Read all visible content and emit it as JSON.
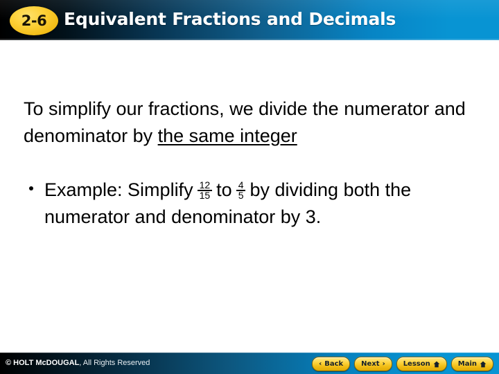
{
  "header": {
    "badge_label": "2-6",
    "title": "Equivalent Fractions and Decimals",
    "gradient_from": "#000000",
    "gradient_to": "#0894d3",
    "badge_color": "#fdd037"
  },
  "body": {
    "paragraph": {
      "lead": "To simplify our fractions, we divide the numerator and denominator by ",
      "emphasis": "the same integer"
    },
    "bullet": {
      "marker": "bullet-dot",
      "part1": "Example:  Simplify",
      "fraction1": {
        "numerator": "12",
        "denominator": "15"
      },
      "part2": "to",
      "fraction2": {
        "numerator": "4",
        "denominator": "5"
      },
      "part3": "by dividing both the numerator and denominator by 3."
    }
  },
  "footer": {
    "copyright_brand": "© HOLT McDOUGAL",
    "copyright_rest": ", All Rights Reserved",
    "buttons": [
      {
        "label": "Back",
        "icon": "chevron-left-icon",
        "glyph": "‹"
      },
      {
        "label": "Next",
        "icon": "chevron-right-icon",
        "glyph": "›"
      },
      {
        "label": "Lesson",
        "icon": "home-icon",
        "glyph": ""
      },
      {
        "label": "Main",
        "icon": "home-icon",
        "glyph": ""
      }
    ],
    "accent_color": "#fdd43f"
  }
}
